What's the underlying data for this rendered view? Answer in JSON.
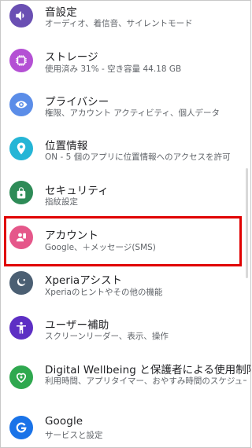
{
  "settings": {
    "items": [
      {
        "title": "音設定",
        "subtitle": "オーディオ、着信音、サイレントモード",
        "icon": "volume-icon",
        "color": "#6a4fb3"
      },
      {
        "title": "ストレージ",
        "subtitle": "使用済み 31% - 空き容量 44.18 GB",
        "icon": "storage-icon",
        "color": "#b450d4"
      },
      {
        "title": "プライバシー",
        "subtitle": "権限、アカウント アクティビティ、個人データ",
        "icon": "privacy-eye-icon",
        "color": "#5b8de8"
      },
      {
        "title": "位置情報",
        "subtitle": "ON - 5 個のアプリに位置情報へのアクセスを許可",
        "icon": "location-pin-icon",
        "color": "#25b5d6"
      },
      {
        "title": "セキュリティ",
        "subtitle": "指紋設定",
        "icon": "lock-icon",
        "color": "#2e8b57"
      },
      {
        "title": "アカウント",
        "subtitle": "Google、＋メッセージ(SMS)",
        "icon": "account-icon",
        "color": "#e5578a"
      },
      {
        "title": "Xperiaアシスト",
        "subtitle": "Xperiaのヒントやその他の機能",
        "icon": "xperia-assist-icon",
        "color": "#4b5f73"
      },
      {
        "title": "ユーザー補助",
        "subtitle": "スクリーンリーダー、表示、操作",
        "icon": "accessibility-icon",
        "color": "#5d2fc4"
      },
      {
        "title": "Digital Wellbeing と保護者による使用制限",
        "subtitle": "利用時間、アプリタイマー、おやすみ時間のスケジュール",
        "icon": "digital-wellbeing-icon",
        "color": "#2fa84f"
      },
      {
        "title": "Google",
        "subtitle": "サービスと設定",
        "icon": "google-icon",
        "color": "#1a73e8"
      }
    ]
  },
  "highlight_color": "#e00000"
}
